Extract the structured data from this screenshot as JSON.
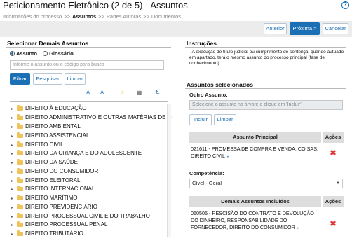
{
  "header": {
    "title": "Peticionamento Eletrônico (2 de 5) - Assuntos",
    "help_icon": "help-circle-icon"
  },
  "breadcrumb": {
    "items": [
      "Informações do processo",
      "Assuntos",
      "Partes Autoras",
      "Documentos"
    ],
    "separator": ">>"
  },
  "top_actions": {
    "previous": "Anterior",
    "next": "Próxima >",
    "cancel": "Cancelar"
  },
  "left_panel": {
    "title": "Selecionar Demais Assuntos",
    "radio_subject": "Assunto",
    "radio_glossary": "Glossário",
    "search_placeholder": "Informe o assunto ou o código para busca",
    "filter_button": "Filtrar",
    "search_button": "Pesquisar",
    "clear_button": "Limpar",
    "tree_items": [
      "DIREITO À EDUCAÇÃO",
      "DIREITO ADMINISTRATIVO E OUTRAS MATÉRIAS DE D",
      "DIREITO AMBIENTAL",
      "DIREITO ASSISTENCIAL",
      "DIREITO CIVIL",
      "DIREITO DA CRIANÇA E DO ADOLESCENTE",
      "DIREITO DA SAÚDE",
      "DIREITO DO CONSUMIDOR",
      "DIREITO ELEITORAL",
      "DIREITO INTERNACIONAL",
      "DIREITO MARÍTIMO",
      "DIREITO PREVIDENCIÁRIO",
      "DIREITO PROCESSUAL CIVIL E DO TRABALHO",
      "DIREITO PROCESSUAL PENAL",
      "DIREITO TRIBUTÁRIO"
    ]
  },
  "instructions": {
    "title": "Instruções",
    "text": "- A execução de título judicial ou cumprimento de sentença, quando autuado em apartado, terá o mesmo assunto do processo principal (fase de conhecimento)."
  },
  "selected_subjects": {
    "title": "Assuntos selecionados",
    "other_subject_label": "Outro Assunto:",
    "other_subject_placeholder": "Selecione o assunto na árvore e clique em 'Incluir'",
    "include_button": "Incluir",
    "clear_button": "Limpar",
    "main_table": {
      "col_subject": "Assunto Principal",
      "col_actions": "Ações",
      "row_text": "021611 - PROMESSA DE COMPRA E VENDA, COISAS, DIREITO CIVIL"
    },
    "competencia_label": "Competência:",
    "competencia_value": "Cível - Geral",
    "other_table": {
      "col_subject": "Demais Assuntos Incluídos",
      "col_actions": "Ações",
      "row_text": "060505 - RESCISÃO DO CONTRATO E DEVOLUÇÃO DO DINHEIRO, RESPONSABILIDADE DO FORNECEDOR, DIREITO DO CONSUMIDOR"
    }
  }
}
